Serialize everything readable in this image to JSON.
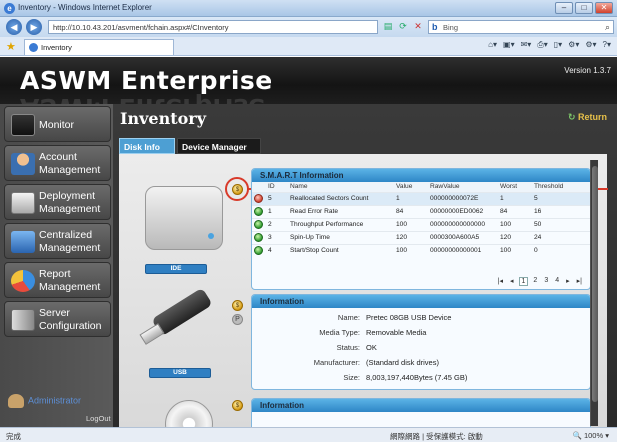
{
  "browser": {
    "window_title": "Inventory - Windows Internet Explorer",
    "url": "http://10.10.43.201/asvment/fchain.aspx#/CInventory",
    "search_placeholder": "Bing",
    "tab_label": "Inventory",
    "status_left": "完成",
    "status_mid": "網際網路 | 受保護模式: 啟動",
    "zoom": "100%"
  },
  "app": {
    "title": "ASWM Enterprise",
    "version": "Version 1.3.7"
  },
  "sidebar": {
    "items": [
      {
        "label": "Monitor",
        "icon": "monitor-icon"
      },
      {
        "label": "Account Management",
        "line1": "Account",
        "line2": "Management",
        "icon": "account-icon"
      },
      {
        "label": "Deployment Management",
        "line1": "Deployment",
        "line2": "Management",
        "icon": "deployment-icon"
      },
      {
        "label": "Centralized Management",
        "line1": "Centralized",
        "line2": "Management",
        "icon": "centralized-icon"
      },
      {
        "label": "Report Management",
        "line1": "Report",
        "line2": "Management",
        "icon": "report-icon"
      },
      {
        "label": "Server Configuration",
        "line1": "Server",
        "line2": "Configuration",
        "icon": "server-icon"
      }
    ],
    "user": "Administrator",
    "logout": "LogOut"
  },
  "main": {
    "page_title": "Inventory",
    "return_label": "Return",
    "tabs": [
      "Disk Info",
      "Device Manager"
    ],
    "devices": [
      {
        "label": "IDE"
      },
      {
        "label": "USB"
      }
    ]
  },
  "smart": {
    "title": "S.M.A.R.T Information",
    "columns": [
      "ID",
      "Name",
      "Value",
      "RawValue",
      "Worst",
      "Threshold"
    ],
    "rows": [
      {
        "status": "warn",
        "id": "5",
        "name": "Reallocated Sectors Count",
        "value": "1",
        "raw": "000000000072E",
        "worst": "1",
        "threshold": "5"
      },
      {
        "status": "ok",
        "id": "1",
        "name": "Read Error Rate",
        "value": "84",
        "raw": "00000000ED0062",
        "worst": "84",
        "threshold": "16"
      },
      {
        "status": "ok",
        "id": "2",
        "name": "Throughput Performance",
        "value": "100",
        "raw": "000000000000000",
        "worst": "100",
        "threshold": "50"
      },
      {
        "status": "ok",
        "id": "3",
        "name": "Spin-Up Time",
        "value": "120",
        "raw": "0000300A600A5",
        "worst": "120",
        "threshold": "24"
      },
      {
        "status": "ok",
        "id": "4",
        "name": "Start/Stop Count",
        "value": "100",
        "raw": "00000000000001",
        "worst": "100",
        "threshold": "0"
      }
    ],
    "pager": {
      "first": "|◂",
      "prev": "◂",
      "pages": [
        "1",
        "2",
        "3",
        "4"
      ],
      "next": "▸",
      "last": "▸|"
    }
  },
  "usb_info": {
    "title": "Information",
    "fields": [
      {
        "key": "Name:",
        "value": "Pretec 08GB USB Device"
      },
      {
        "key": "Media Type:",
        "value": "Removable Media"
      },
      {
        "key": "Status:",
        "value": "OK"
      },
      {
        "key": "Manufacturer:",
        "value": "(Standard disk drives)"
      },
      {
        "key": "Size:",
        "value": "8,003,197,440Bytes (7.45 GB)"
      }
    ]
  },
  "dvd_info": {
    "title": "Information"
  }
}
